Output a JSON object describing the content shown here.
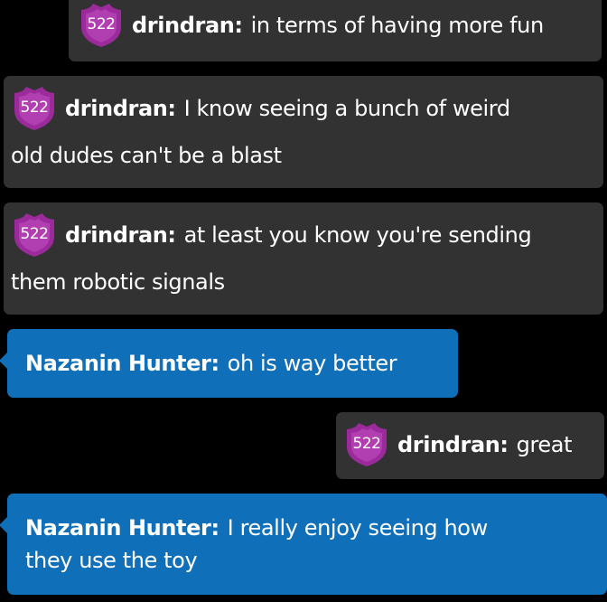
{
  "messages": [
    {
      "badge": "522",
      "username": "drindran:",
      "text": "in terms of having more fun",
      "continuation": ""
    },
    {
      "badge": "522",
      "username": "drindran:",
      "text": "I know seeing a bunch of weird",
      "continuation": "old dudes can't be a blast"
    },
    {
      "badge": "522",
      "username": "drindran:",
      "text": "at least you know you're sending",
      "continuation": "them robotic signals"
    },
    {
      "badge": "",
      "username": "Nazanin Hunter:",
      "text": "oh is way better",
      "continuation": ""
    },
    {
      "badge": "522",
      "username": "drindran:",
      "text": "great",
      "continuation": ""
    },
    {
      "badge": "",
      "username": "Nazanin Hunter:",
      "text": "I really enjoy seeing how",
      "continuation": "they use the toy"
    }
  ],
  "colors": {
    "background": "#000000",
    "viewer_bubble": "#323232",
    "host_bubble": "#0f6fb8",
    "badge_shield": "#9b2a9b",
    "text": "#ffffff"
  },
  "icons": {
    "badge": "shield-badge-icon"
  }
}
